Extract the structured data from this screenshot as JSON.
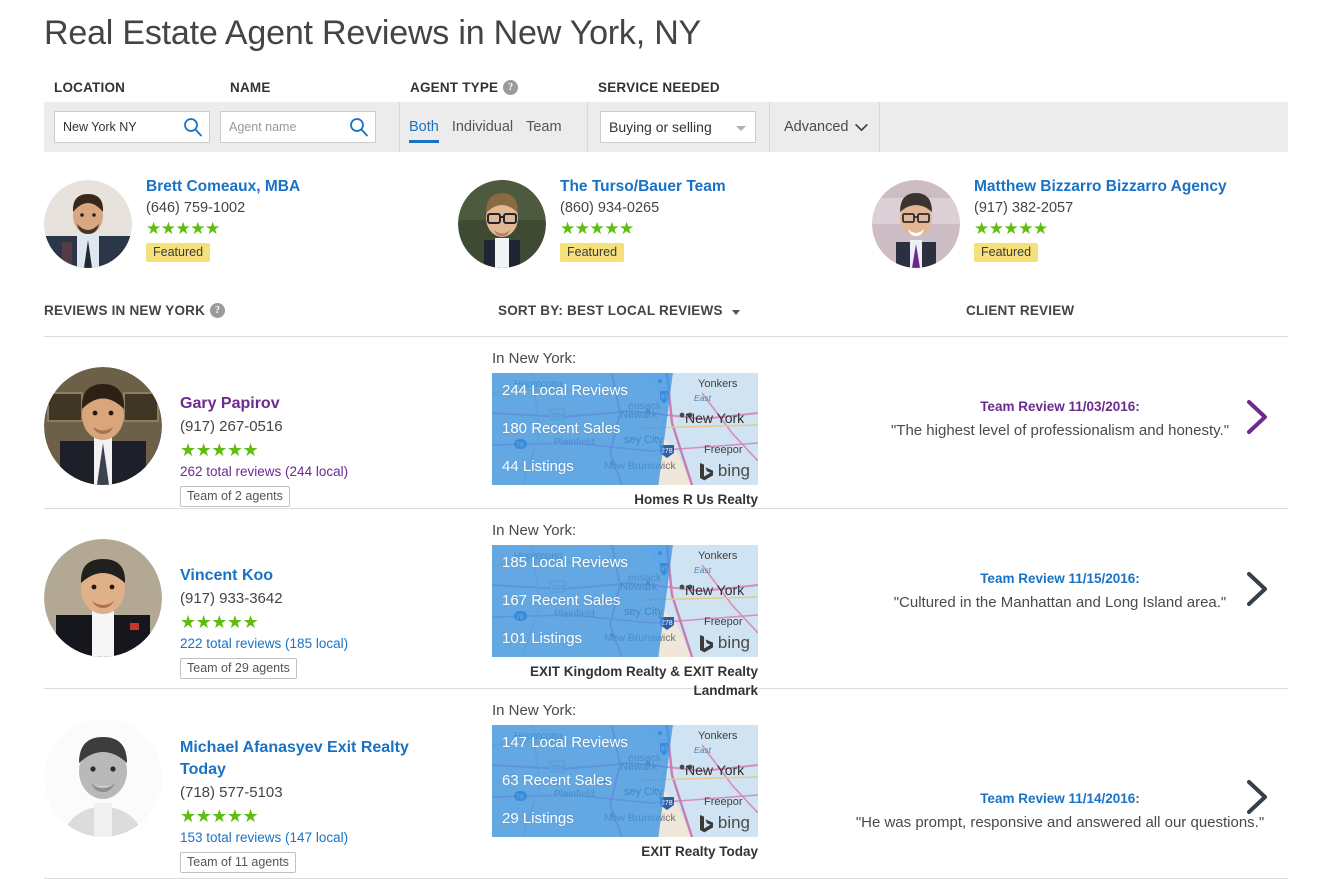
{
  "header": {
    "title": "Real Estate Agent Reviews in New York, NY"
  },
  "filters": {
    "labels": {
      "location": "LOCATION",
      "name": "NAME",
      "agent_type": "AGENT TYPE",
      "service_needed": "SERVICE NEEDED"
    },
    "help_glyph": "?",
    "location_value": "New York NY",
    "location_placeholder": "New York NY",
    "name_value": "",
    "name_placeholder": "Agent name",
    "agent_type_options": [
      "Both",
      "Individual",
      "Team"
    ],
    "agent_type_selected": "Both",
    "service_selected": "Buying or selling",
    "advanced_label": "Advanced",
    "accent_blue": "#1a72c4",
    "bar_bg": "#ececec"
  },
  "featured": [
    {
      "name": "Brett Comeaux, MBA",
      "phone": "(646) 759-1002",
      "stars": "★★★★★",
      "badge": "Featured"
    },
    {
      "name": "The Turso/Bauer Team",
      "phone": "(860) 934-0265",
      "stars": "★★★★★",
      "badge": "Featured"
    },
    {
      "name": "Matthew Bizzarro Bizzarro Agency",
      "phone": "(917) 382-2057",
      "stars": "★★★★★",
      "badge": "Featured"
    }
  ],
  "columns": {
    "reviews_in": "REVIEWS IN NEW YORK",
    "sort_by": "SORT BY: BEST LOCAL REVIEWS",
    "client_review": "CLIENT REVIEW"
  },
  "rows": [
    {
      "name": "Gary Papirov",
      "phone": "(917) 267-0516",
      "stars": "★★★★★",
      "totals": "262 total reviews (244 local)",
      "team": "Team of 2 agents",
      "in_city": "In New York:",
      "local_reviews": "244 Local Reviews",
      "recent_sales": "180 Recent Sales",
      "listings": "44 Listings",
      "brokerage": "Homes R Us Realty",
      "bing_label": "bing",
      "review_head": "Team Review 11/03/2016:",
      "review_quote": "\"The highest level of professionalism and honesty.\"",
      "visited": true
    },
    {
      "name": "Vincent Koo",
      "phone": "(917) 933-3642",
      "stars": "★★★★★",
      "totals": "222 total reviews (185 local)",
      "team": "Team of 29 agents",
      "in_city": "In New York:",
      "local_reviews": "185 Local Reviews",
      "recent_sales": "167 Recent Sales",
      "listings": "101 Listings",
      "brokerage": "EXIT Kingdom Realty & EXIT Realty Landmark",
      "bing_label": "bing",
      "review_head": "Team Review 11/15/2016:",
      "review_quote": "\"Cultured in the Manhattan and Long Island area.\"",
      "visited": false
    },
    {
      "name": "Michael Afanasyev Exit Realty Today",
      "phone": "(718) 577-5103",
      "stars": "★★★★★",
      "totals": "153 total reviews (147 local)",
      "team": "Team of 11 agents",
      "in_city": "In New York:",
      "local_reviews": "147 Local Reviews",
      "recent_sales": "63 Recent Sales",
      "listings": "29 Listings",
      "brokerage": "EXIT Realty Today",
      "bing_label": "bing",
      "review_head": "Team Review 11/14/2016:",
      "review_quote": "\"He was prompt, responsive and answered all our questions.\"",
      "visited": false
    }
  ],
  "map_labels": {
    "places": [
      "Hopatcong",
      "Newark",
      "Plainfield",
      "New Brunswick",
      "ensack",
      "sey City",
      "Yonkers",
      "New York",
      "Freepor",
      "East"
    ],
    "shields": [
      "206",
      "95",
      "278",
      "78"
    ]
  },
  "colors": {
    "link": "#1a72c4",
    "visited": "#6b2a8f",
    "star_green": "#5fbd10",
    "badge_yellow": "#f6e07a",
    "map_blue": "#3c96e6"
  }
}
